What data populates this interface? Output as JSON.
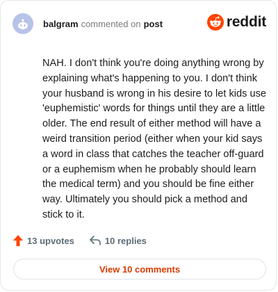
{
  "comment": {
    "author": "balgram",
    "action": "commented on",
    "post_link": "post",
    "body": "NAH. I don't think you're doing anything wrong by explaining what's happening to you. I don't think your husband is wrong in his desire to let kids use 'euphemistic' words for things until they are a little older. The end result of either method will have a weird transition period (either when your kid says a word in class that catches the teacher off-guard or a euphemism when he probably should learn the medical term) and you should be fine either way. Ultimately you should pick a method and stick to it."
  },
  "brand": {
    "wordmark": "reddit",
    "color": "#ff4500"
  },
  "footer": {
    "upvotes": "13 upvotes",
    "replies": "10 replies",
    "view_comments": "View 10 comments"
  },
  "colors": {
    "accent": "#d93a00",
    "upvote_arrow": "#ff4500",
    "avatar_bg": "#b7c3e7"
  },
  "icons": [
    "snoo-avatar-icon",
    "reddit-logo-icon",
    "upvote-arrow-icon",
    "reply-arrow-icon"
  ]
}
